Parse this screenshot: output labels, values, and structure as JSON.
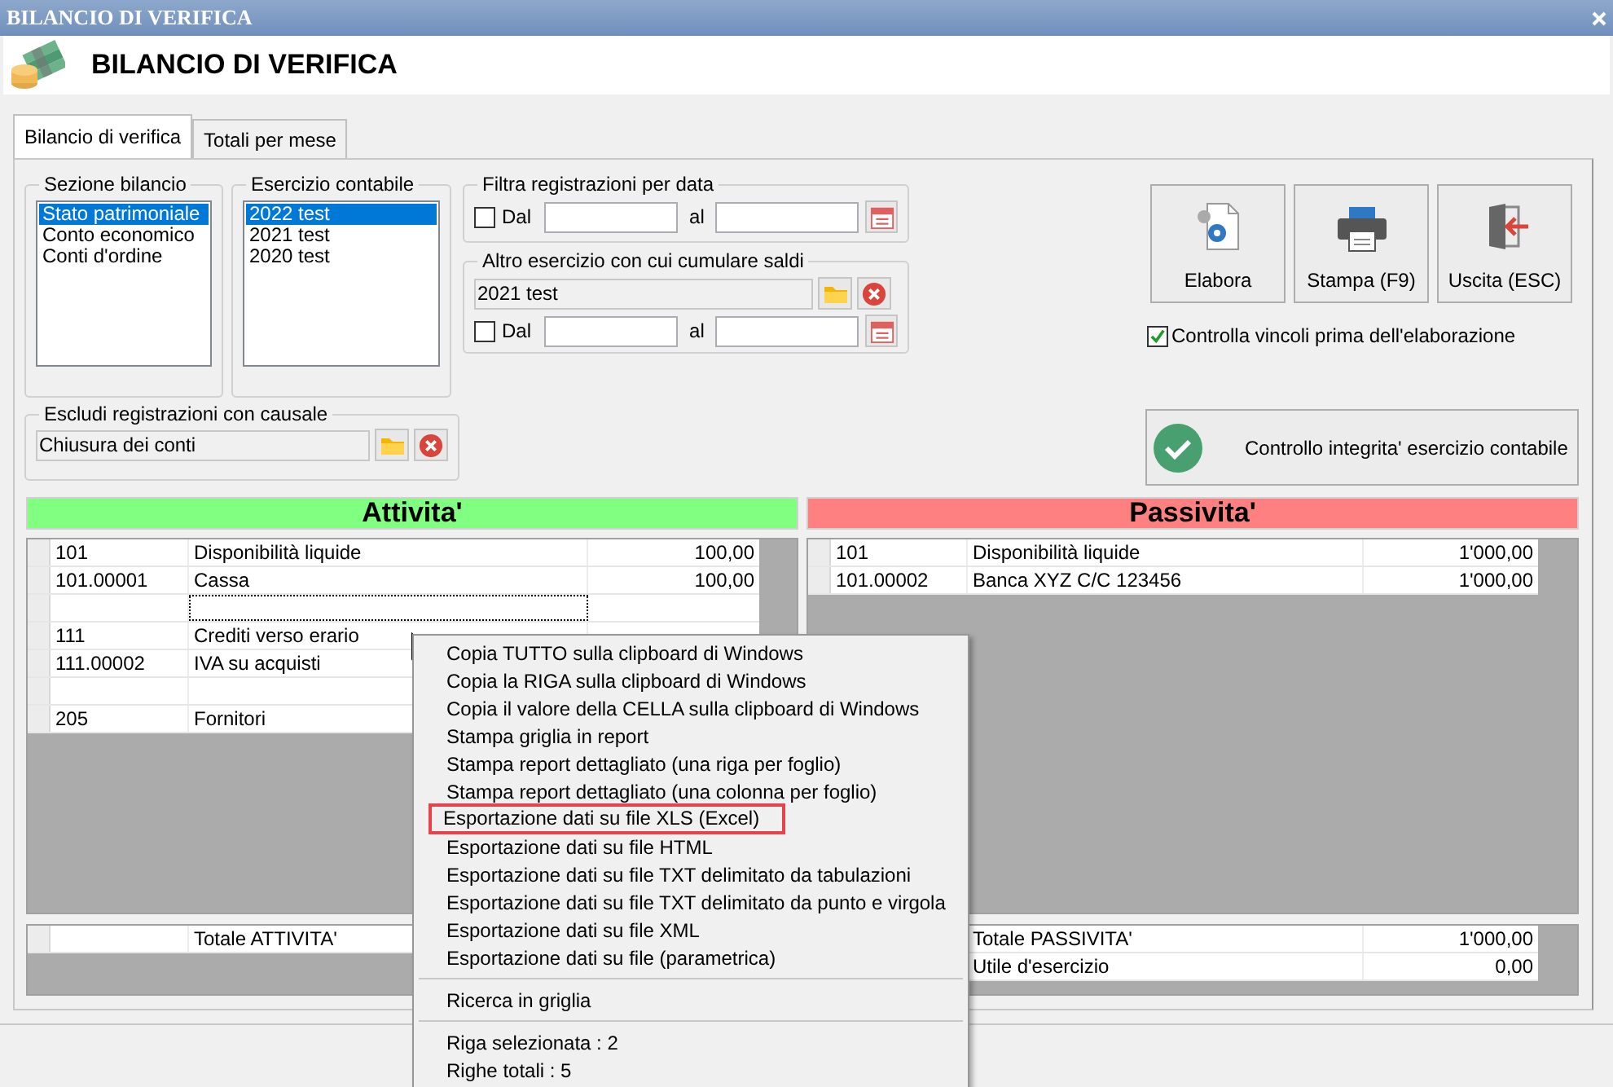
{
  "window": {
    "title": "BILANCIO DI VERIFICA"
  },
  "header": {
    "title": "BILANCIO DI VERIFICA"
  },
  "tabs": [
    {
      "label": "Bilancio di verifica",
      "selected": true
    },
    {
      "label": "Totali per mese",
      "selected": false
    }
  ],
  "sezione_bilancio": {
    "label": "Sezione bilancio",
    "items": [
      {
        "label": "Stato patrimoniale",
        "selected": true
      },
      {
        "label": "Conto economico",
        "selected": false
      },
      {
        "label": "Conti d'ordine",
        "selected": false
      }
    ]
  },
  "esercizio_contabile": {
    "label": "Esercizio contabile",
    "items": [
      {
        "label": "2022 test",
        "selected": true
      },
      {
        "label": "2021 test",
        "selected": false
      },
      {
        "label": "2020 test",
        "selected": false
      }
    ]
  },
  "filtra_data": {
    "label": "Filtra registrazioni per data",
    "dal": {
      "label": "Dal",
      "checked": false
    },
    "al_label": "al"
  },
  "altro_esercizio": {
    "label": "Altro esercizio con cui cumulare saldi",
    "value": "2021 test",
    "dal": {
      "label": "Dal",
      "checked": false
    },
    "al_label": "al"
  },
  "escludi_causale": {
    "label": "Escludi registrazioni con causale",
    "value": "Chiusura dei conti"
  },
  "buttons": [
    {
      "label": "Elabora",
      "kind": "process"
    },
    {
      "label": "Stampa (F9)",
      "kind": "print"
    },
    {
      "label": "Uscita (ESC)",
      "kind": "exit"
    }
  ],
  "check_vincoli": {
    "label": "Controlla vincoli prima dell'elaborazione",
    "checked": true
  },
  "controllo_button": {
    "label": "Controllo integrita' esercizio contabile"
  },
  "attivita": {
    "title": "Attivita'",
    "color": "#80ff80",
    "rows": [
      {
        "kind": "account",
        "code": "101",
        "description": "Disponibilità liquide",
        "amount": "100,00",
        "focused": false
      },
      {
        "kind": "account",
        "code": "101.00001",
        "description": "Cassa",
        "amount": "100,00",
        "focused": false
      },
      {
        "kind": "blank",
        "focused": true
      },
      {
        "kind": "account",
        "code": "111",
        "description": "Crediti verso erario",
        "focused": false
      },
      {
        "kind": "account",
        "code": "111.00002",
        "description": "IVA su acquisti",
        "focused": false
      },
      {
        "kind": "blank",
        "focused": false
      },
      {
        "kind": "account",
        "code": "205",
        "description": "Fornitori",
        "focused": false
      }
    ],
    "totals": [
      {
        "description": "Totale ATTIVITA'"
      }
    ]
  },
  "passivita": {
    "title": "Passivita'",
    "color": "#ff8080",
    "rows": [
      {
        "kind": "account",
        "code": "101",
        "description": "Disponibilità liquide",
        "amount": "1'000,00",
        "focused": false
      },
      {
        "kind": "account",
        "code": "101.00002",
        "description": "Banca XYZ C/C 123456",
        "amount": "1'000,00",
        "focused": false
      }
    ],
    "totals": [
      {
        "description": "Totale PASSIVITA'",
        "amount": "1'000,00"
      },
      {
        "description": "Utile d'esercizio",
        "amount": "0,00"
      }
    ]
  },
  "context_menu": {
    "groups": [
      [
        {
          "label": "Copia TUTTO sulla clipboard di Windows",
          "outlined": false
        },
        {
          "label": "Copia la RIGA sulla clipboard di Windows",
          "outlined": false
        },
        {
          "label": "Copia il valore della CELLA sulla clipboard di Windows",
          "outlined": false
        },
        {
          "label": "Stampa griglia in report",
          "outlined": false
        },
        {
          "label": "Stampa report dettagliato (una riga per foglio)",
          "outlined": false
        },
        {
          "label": "Stampa report dettagliato (una colonna per foglio)",
          "outlined": false
        },
        {
          "label": "Esportazione dati su file XLS (Excel)",
          "outlined": true
        },
        {
          "label": "Esportazione dati su file HTML",
          "outlined": false
        },
        {
          "label": "Esportazione dati su file TXT delimitato da tabulazioni",
          "outlined": false
        },
        {
          "label": "Esportazione dati su file TXT delimitato da punto e virgola",
          "outlined": false
        },
        {
          "label": "Esportazione dati su file XML",
          "outlined": false
        },
        {
          "label": "Esportazione dati su file (parametrica)",
          "outlined": false
        }
      ],
      [
        {
          "label": "Ricerca in griglia",
          "outlined": false
        }
      ],
      [
        {
          "label": "Riga selezionata : 2",
          "outlined": false
        },
        {
          "label": "Righe totali : 5",
          "outlined": false
        }
      ]
    ]
  }
}
